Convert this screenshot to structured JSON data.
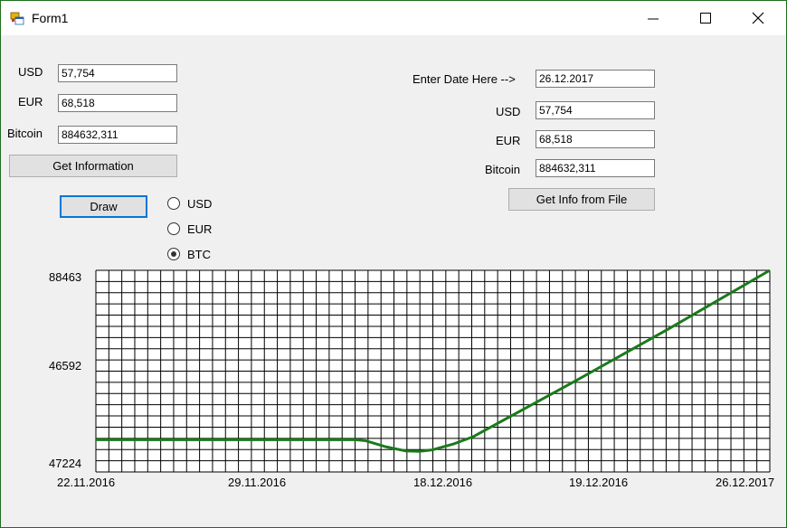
{
  "window": {
    "title": "Form1"
  },
  "left_panel": {
    "usd_label": "USD",
    "usd_value": "57,754",
    "eur_label": "EUR",
    "eur_value": "68,518",
    "btc_label": "Bitcoin",
    "btc_value": "884632,311",
    "get_info_button": "Get  Information"
  },
  "right_panel": {
    "date_label": "Enter Date Here -->",
    "date_value": "26.12.2017",
    "usd_label": "USD",
    "usd_value": "57,754",
    "eur_label": "EUR",
    "eur_value": "68,518",
    "btc_label": "Bitcoin",
    "btc_value": "884632,311",
    "file_button": "Get Info from File"
  },
  "draw_button": "Draw",
  "currency_options": [
    {
      "label": "USD",
      "checked": false
    },
    {
      "label": "EUR",
      "checked": false
    },
    {
      "label": "BTC",
      "checked": true
    }
  ],
  "chart_data": {
    "type": "line",
    "y_tick_labels": [
      "88463",
      "46592",
      "47224"
    ],
    "x_tick_labels": [
      "22.11.2016",
      "29.11.2016",
      "18.12.2016",
      "19.12.2016",
      "26.12.2017"
    ],
    "grid": true,
    "line_color": "#1a7a1a",
    "series": [
      {
        "values": [
          [
            0.0,
            0.16
          ],
          [
            0.385,
            0.16
          ],
          [
            0.4,
            0.155
          ],
          [
            0.43,
            0.125
          ],
          [
            0.46,
            0.104
          ],
          [
            0.48,
            0.102
          ],
          [
            0.5,
            0.11
          ],
          [
            0.53,
            0.138
          ],
          [
            0.56,
            0.175
          ],
          [
            0.7,
            0.43
          ],
          [
            0.85,
            0.71
          ],
          [
            1.0,
            1.0
          ]
        ]
      }
    ]
  }
}
